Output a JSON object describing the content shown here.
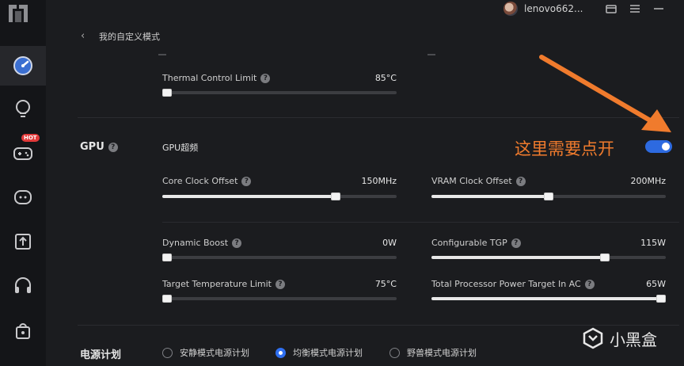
{
  "colors": {
    "accent": "#2d6ae0",
    "annotation": "#f07b2d",
    "background": "#1b1c1f",
    "sidebar": "#141518"
  },
  "sidebar": {
    "items": [
      {
        "icon": "performance-gauge-icon",
        "active": true
      },
      {
        "icon": "lightbulb-icon",
        "active": false
      },
      {
        "icon": "gamepad-icon",
        "active": false,
        "badge": "HOT"
      },
      {
        "icon": "chat-bubble-icon",
        "active": false
      },
      {
        "icon": "upload-box-icon",
        "active": false
      },
      {
        "icon": "headset-icon",
        "active": false
      },
      {
        "icon": "shopping-bag-icon",
        "active": false
      }
    ]
  },
  "topbar": {
    "username": "lenovo662...",
    "icons": [
      "gift-box-icon",
      "menu-icon",
      "minimize-icon"
    ]
  },
  "page": {
    "back_icon": "‹",
    "title": "我的自定义模式"
  },
  "thermal": {
    "label": "Thermal Control Limit",
    "value": "85°C",
    "level": 0
  },
  "gpu": {
    "section_label": "GPU",
    "overclock_label": "GPU超频",
    "overclock_enabled": true,
    "sliders": {
      "core_clock": {
        "label": "Core Clock Offset",
        "value": "150MHz",
        "level": 0.75
      },
      "vram_clock": {
        "label": "VRAM Clock Offset",
        "value": "200MHz",
        "level": 0.5
      },
      "dynamic_boost": {
        "label": "Dynamic Boost",
        "value": "0W",
        "level": 0
      },
      "configurable_tgp": {
        "label": "Configurable TGP",
        "value": "115W",
        "level": 0.75
      },
      "target_temp": {
        "label": "Target Temperature Limit",
        "value": "75°C",
        "level": 0
      },
      "total_power": {
        "label": "Total Processor Power Target In AC",
        "value": "65W",
        "level": 1
      }
    }
  },
  "annotation": {
    "text": "这里需要点开"
  },
  "power_plan": {
    "title": "电源计划",
    "options": [
      {
        "label": "安静模式电源计划",
        "selected": false
      },
      {
        "label": "均衡模式电源计划",
        "selected": true
      },
      {
        "label": "野兽模式电源计划",
        "selected": false
      }
    ]
  },
  "watermark": {
    "text": "小黑盒"
  }
}
